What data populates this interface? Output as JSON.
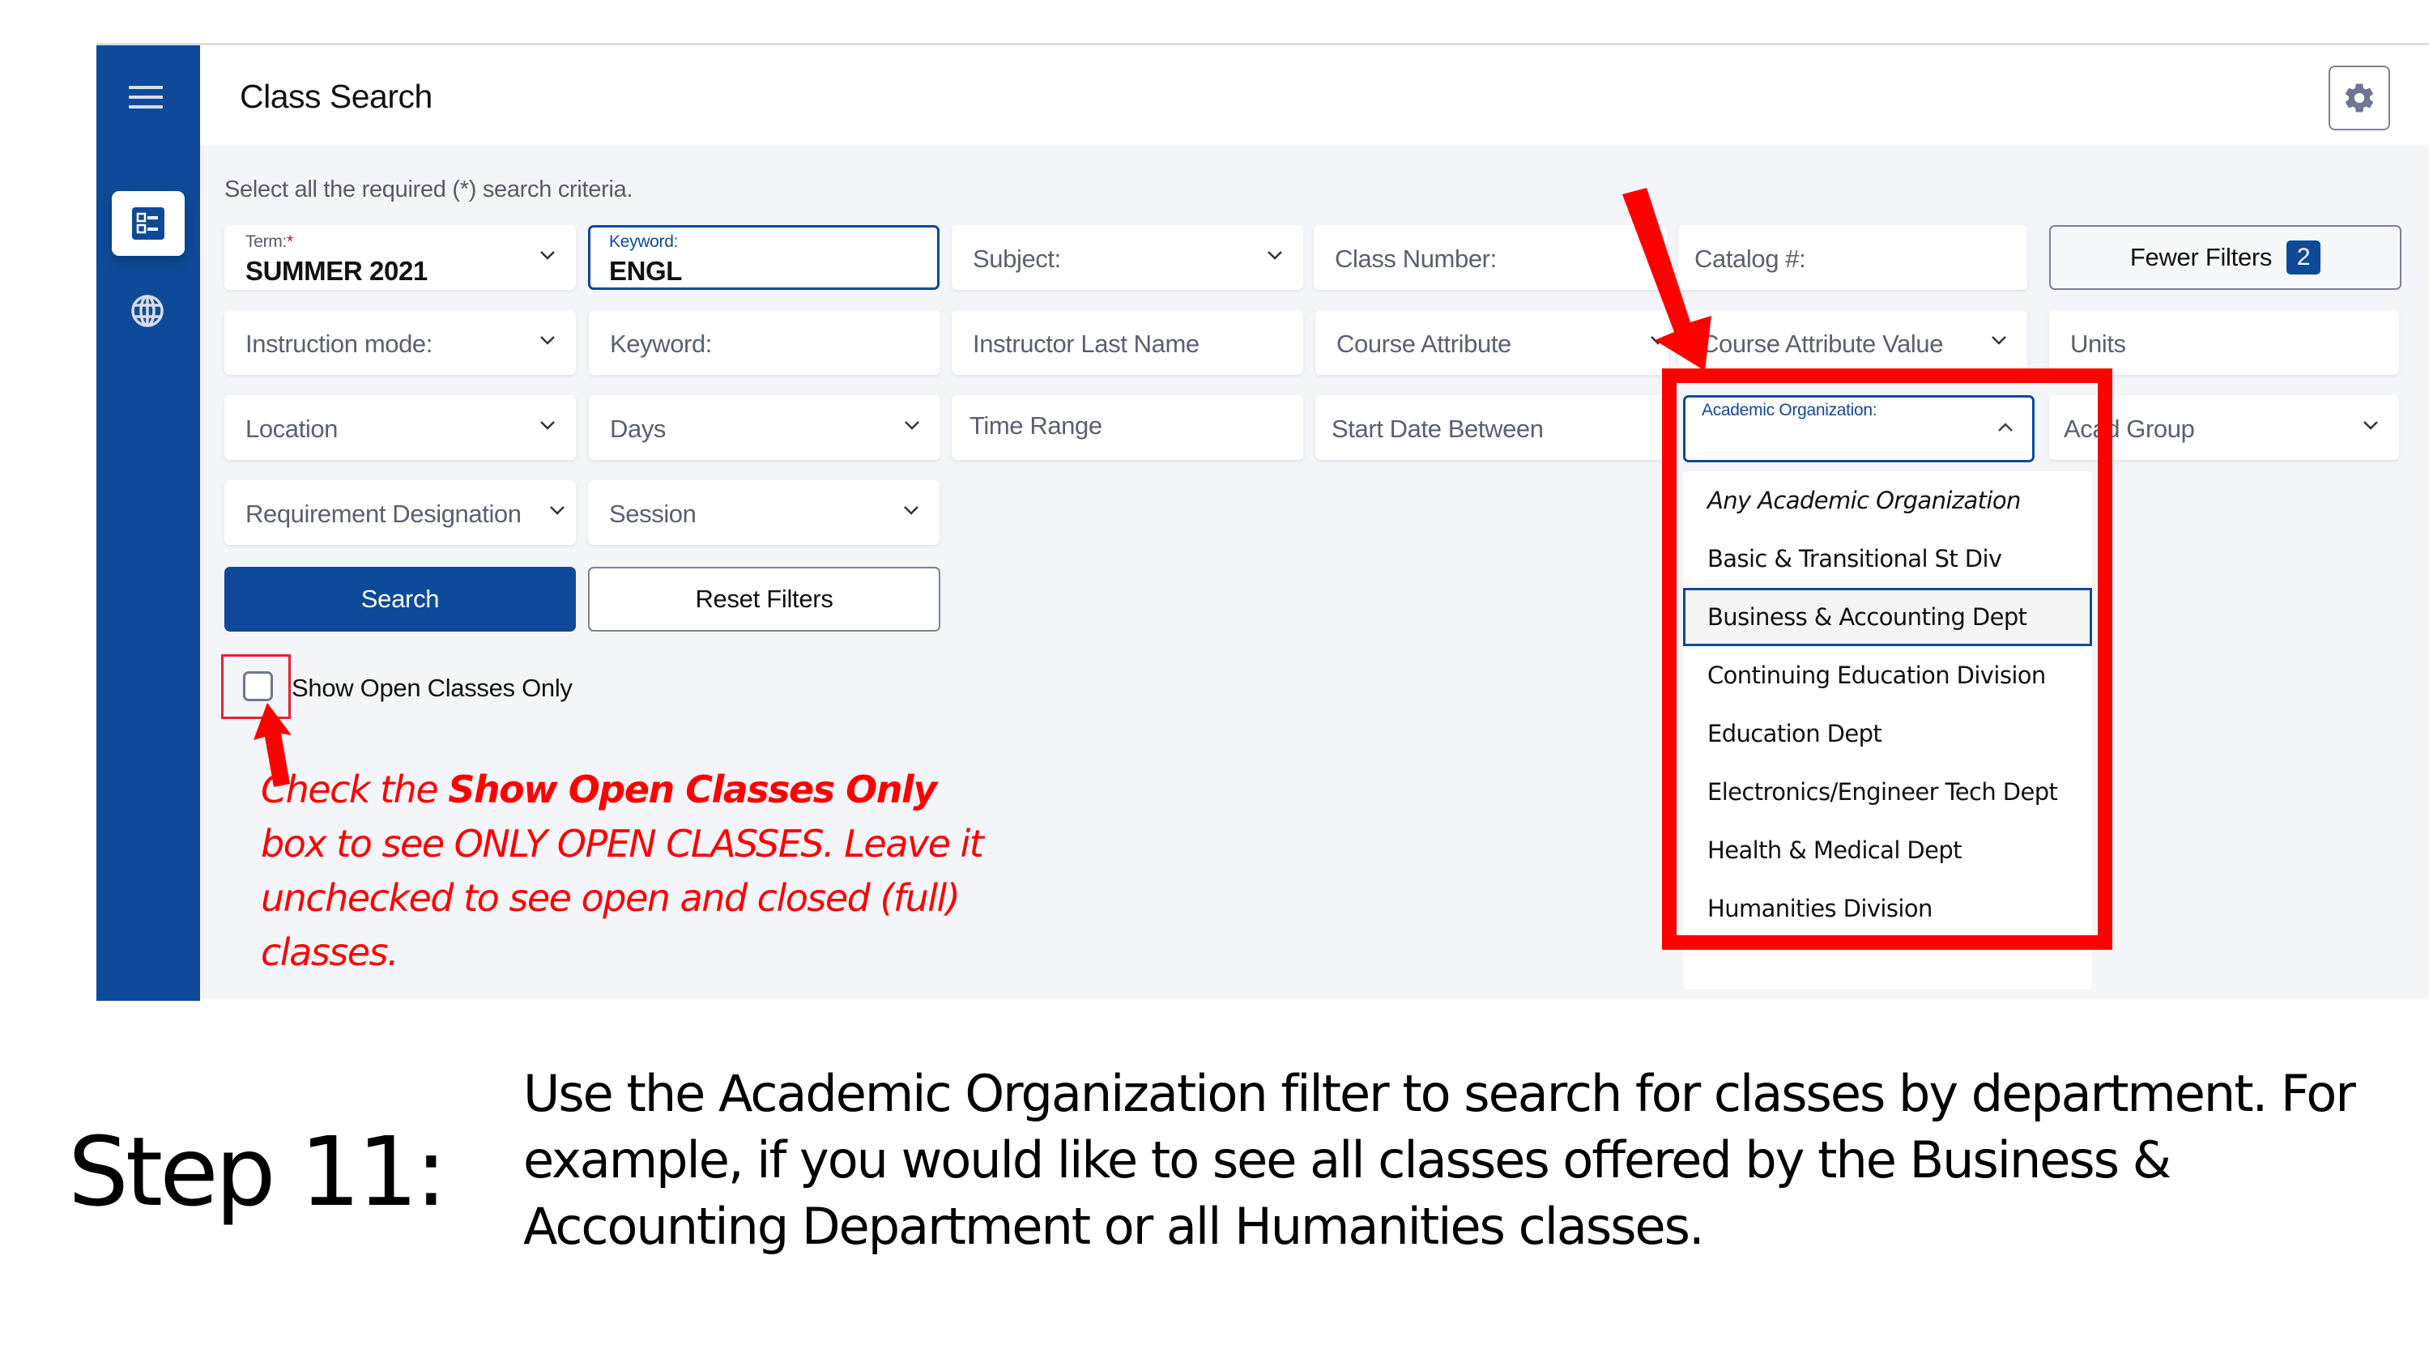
{
  "header": {
    "title": "Class Search"
  },
  "sidebar": {
    "items": [
      {
        "icon": "hamburger-menu-icon"
      },
      {
        "icon": "class-search-icon",
        "active": true
      },
      {
        "icon": "globe-icon"
      }
    ]
  },
  "form": {
    "hint": "Select all the required (*) search criteria.",
    "term": {
      "label": "Term:",
      "required_marker": "*",
      "value": "SUMMER 2021"
    },
    "keyword_active": {
      "label": "Keyword:",
      "value": "ENGL"
    },
    "subject": {
      "placeholder": "Subject:"
    },
    "class_number": {
      "placeholder": "Class Number:"
    },
    "catalog": {
      "placeholder": "Catalog #:"
    },
    "fewer_filters": {
      "label": "Fewer Filters",
      "count": "2"
    },
    "instruction_mode": {
      "placeholder": "Instruction mode:"
    },
    "keyword": {
      "placeholder": "Keyword:"
    },
    "instructor_last_name": {
      "placeholder": "Instructor Last Name"
    },
    "course_attribute": {
      "placeholder": "Course Attribute"
    },
    "course_attribute_value": {
      "placeholder": "Course Attribute Value"
    },
    "units": {
      "placeholder": "Units"
    },
    "location": {
      "placeholder": "Location"
    },
    "days": {
      "placeholder": "Days"
    },
    "time_range": {
      "placeholder": "Time Range"
    },
    "start_date_between": {
      "placeholder": "Start Date Between"
    },
    "academic_organization": {
      "label": "Academic Organization:",
      "expanded": true
    },
    "acad_group": {
      "placeholder": "Acad Group"
    },
    "requirement_designation": {
      "placeholder": "Requirement Designation"
    },
    "session": {
      "placeholder": "Session"
    },
    "search_button": "Search",
    "reset_button": "Reset Filters",
    "show_open_only": {
      "label": "Show Open Classes Only",
      "checked": false
    }
  },
  "academic_organization_options": [
    {
      "label": "Any Academic Organization",
      "italic": true
    },
    {
      "label": "Basic & Transitional St Div"
    },
    {
      "label": "Business & Accounting Dept",
      "highlighted": true
    },
    {
      "label": "Continuing Education Division"
    },
    {
      "label": "Education Dept"
    },
    {
      "label": "Electronics/Engineer Tech Dept"
    },
    {
      "label": "Health & Medical Dept"
    },
    {
      "label": "Humanities Division"
    }
  ],
  "annotation": {
    "part1": "Check the ",
    "bold": "Show Open Classes Only",
    "part2": " box to see ONLY OPEN CLASSES. Leave it unchecked to see open and closed (full) classes."
  },
  "caption": {
    "step": "Step 11:",
    "text_before": "Use the ",
    "text_bold": "Academic Organization",
    "text_after": " filter to search for classes by department. For example, if you would like to see all classes offered by the Business & Accounting Department or all Humanities classes."
  },
  "colors": {
    "brand_blue": "#0e4a99",
    "annotation_red": "#ff0000",
    "panel_bg": "#f4f5f9"
  }
}
